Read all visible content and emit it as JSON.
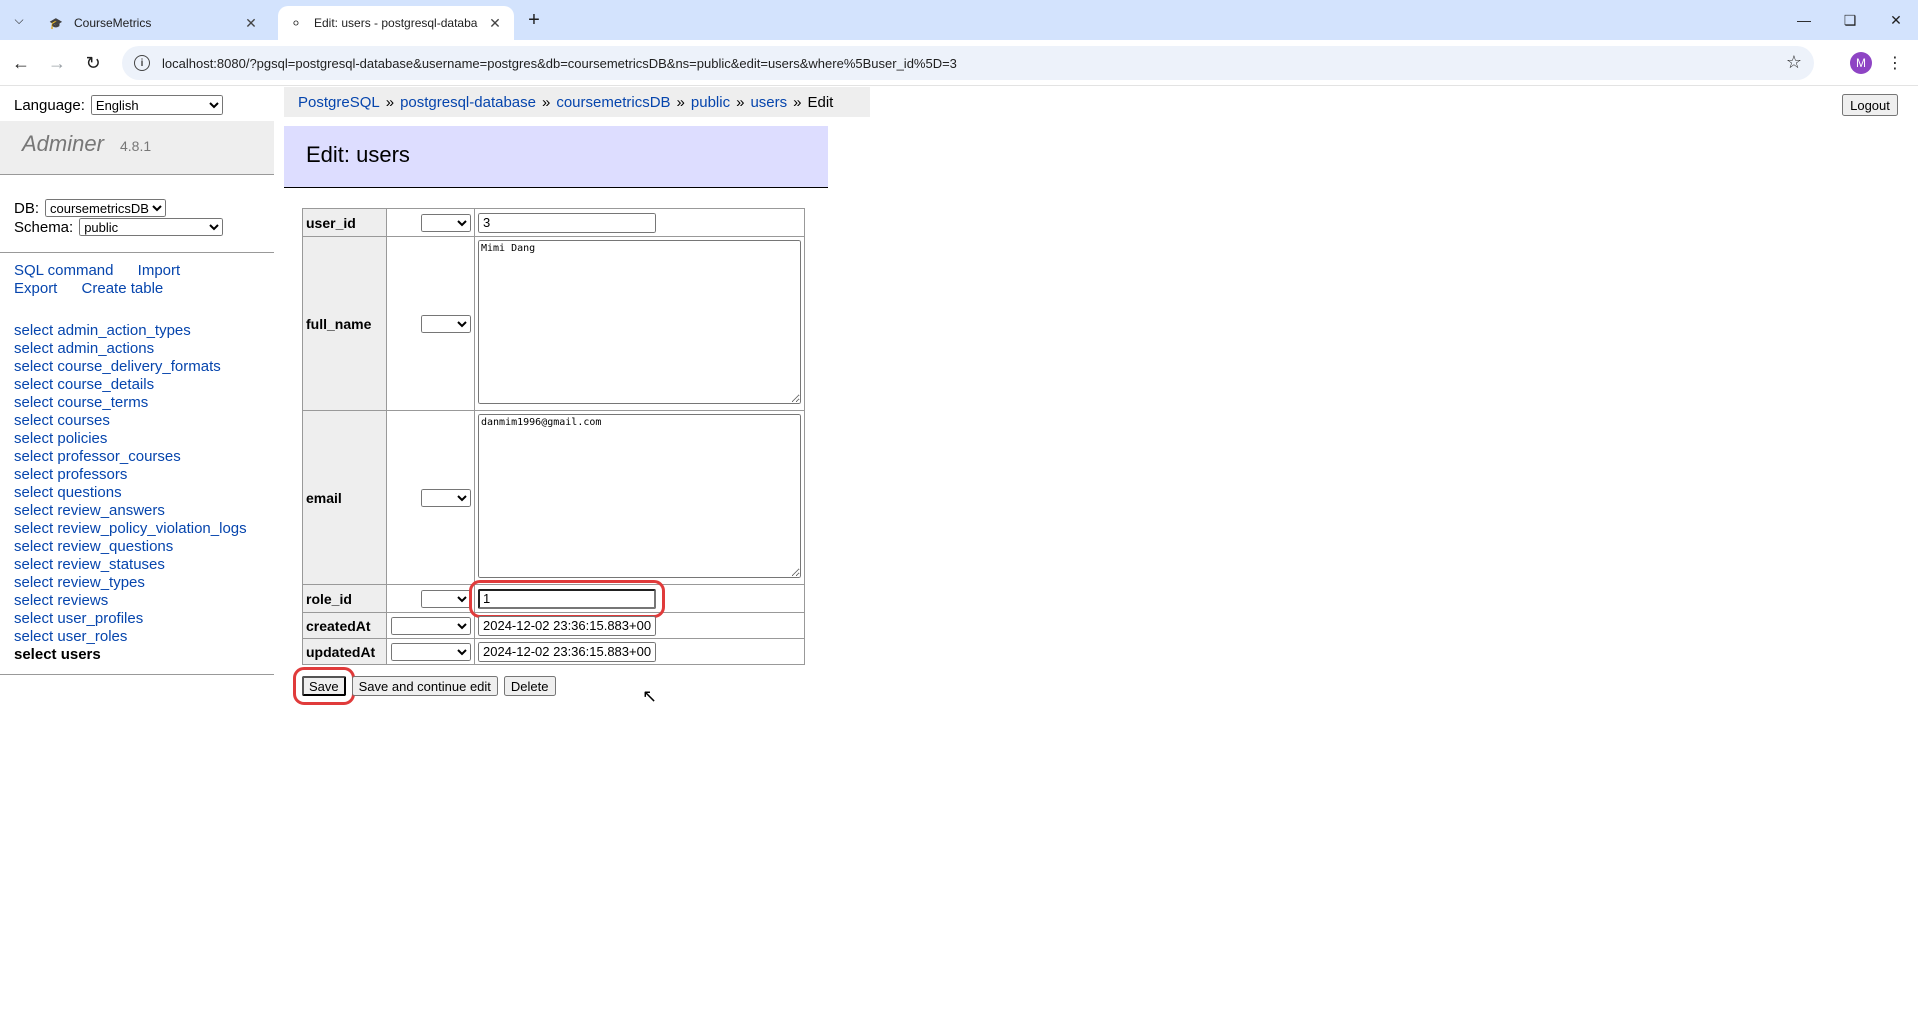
{
  "browser": {
    "tabs": [
      {
        "title": "CourseMetrics",
        "active": false
      },
      {
        "title": "Edit: users - postgresql-databa",
        "active": true
      }
    ],
    "url": "localhost:8080/?pgsql=postgresql-database&username=postgres&db=coursemetricsDB&ns=public&edit=users&where%5Buser_id%5D=3",
    "profile_initial": "M"
  },
  "adminer": {
    "language_label": "Language:",
    "language_value": "English",
    "logo_name": "Adminer",
    "version": "4.8.1",
    "db_label": "DB:",
    "db_value": "coursemetricsDB",
    "schema_label": "Schema:",
    "schema_value": "public",
    "links": {
      "sql_command": "SQL command",
      "import": "Import",
      "export": "Export",
      "create_table": "Create table"
    },
    "tables": [
      "select admin_action_types",
      "select admin_actions",
      "select course_delivery_formats",
      "select course_details",
      "select course_terms",
      "select courses",
      "select policies",
      "select professor_courses",
      "select professors",
      "select questions",
      "select review_answers",
      "select review_policy_violation_logs",
      "select review_questions",
      "select review_statuses",
      "select review_types",
      "select reviews",
      "select user_profiles",
      "select user_roles",
      "select users"
    ],
    "current_table_index": 18,
    "breadcrumb": [
      "PostgreSQL",
      "postgresql-database",
      "coursemetricsDB",
      "public",
      "users",
      "Edit"
    ],
    "breadcrumb_sep": "»",
    "logout_label": "Logout",
    "heading": "Edit: users",
    "fields": {
      "user_id": {
        "label": "user_id",
        "value": "3"
      },
      "full_name": {
        "label": "full_name",
        "value": "Mimi Dang"
      },
      "email": {
        "label": "email",
        "value": "danmim1996@gmail.com"
      },
      "role_id": {
        "label": "role_id",
        "value": "1"
      },
      "createdAt": {
        "label": "createdAt",
        "value": "2024-12-02 23:36:15.883+00"
      },
      "updatedAt": {
        "label": "updatedAt",
        "value": "2024-12-02 23:36:15.883+00"
      }
    },
    "buttons": {
      "save": "Save",
      "save_continue": "Save and continue edit",
      "delete": "Delete"
    },
    "highlight_color": "#e03b3b"
  }
}
